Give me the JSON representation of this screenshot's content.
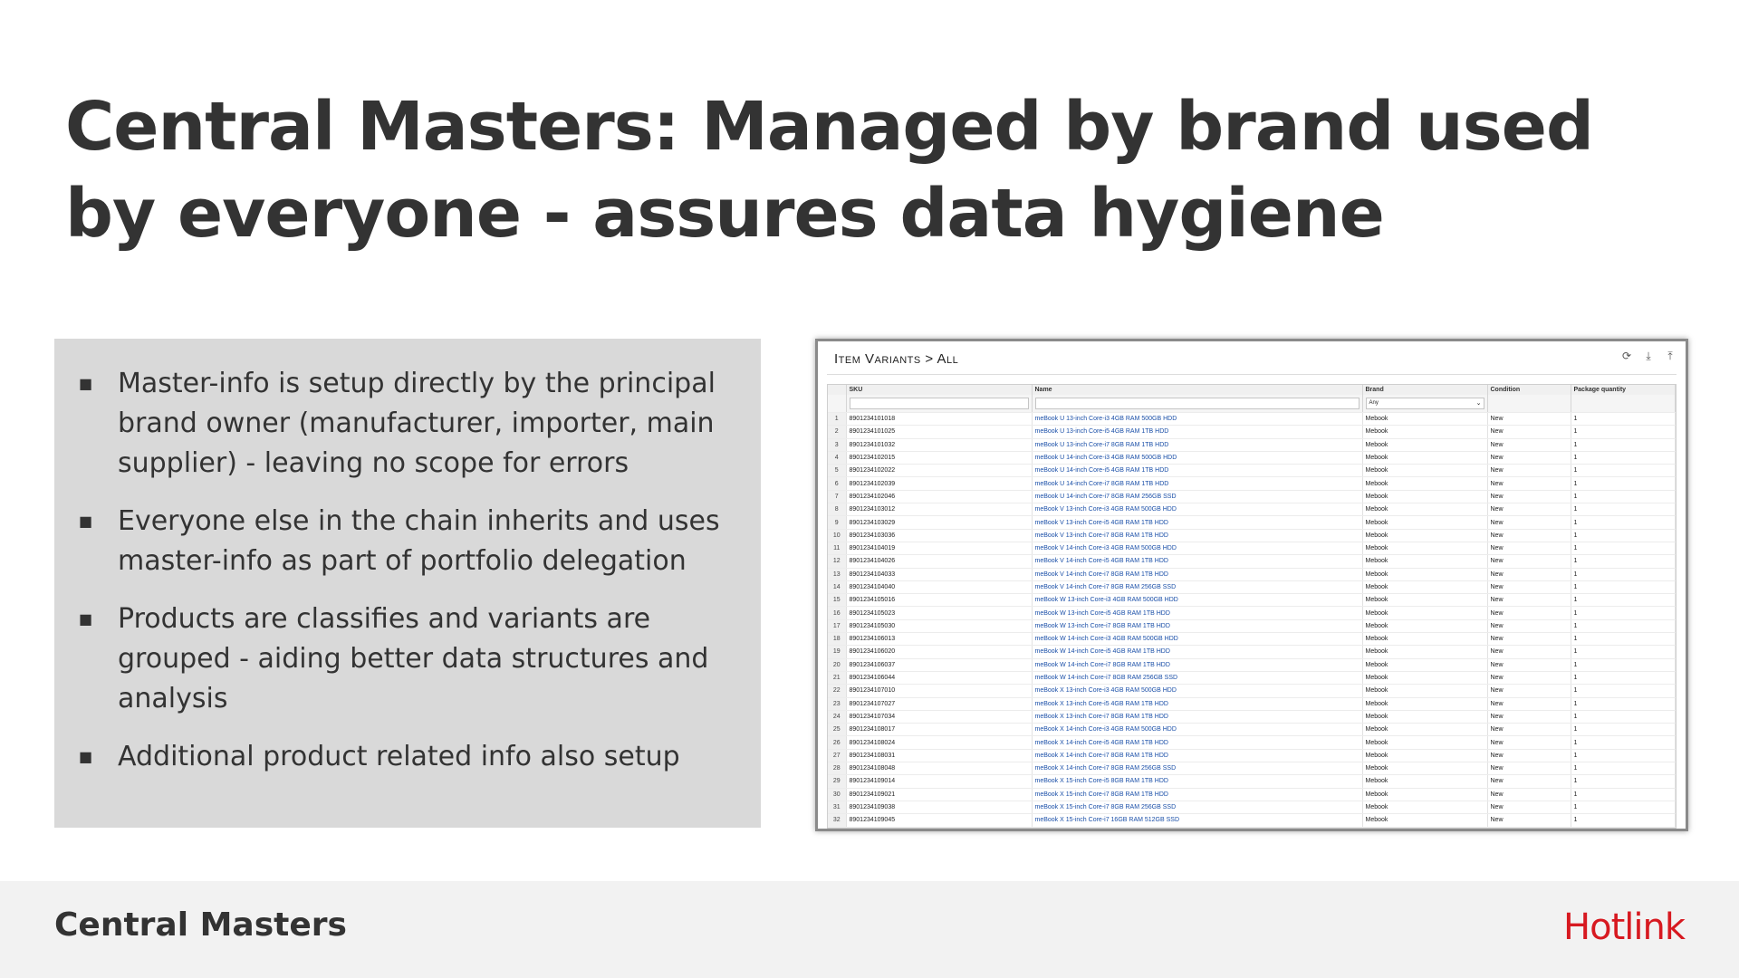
{
  "slide": {
    "title": "Central Masters: Managed by brand used by everyone - assures data hygiene",
    "bullets": [
      "Master-info is setup directly by the principal brand owner (manufacturer, importer, main supplier) - leaving no scope for errors",
      "Everyone else in the chain inherits and uses master-info as part of portfolio delegation",
      "Products are classifies and variants are grouped - aiding better data structures and analysis",
      "Additional product related info also setup"
    ],
    "bullet_marker": "■"
  },
  "screenshot": {
    "title": "Item Variants > All",
    "icons": [
      "refresh-icon",
      "download-icon",
      "upload-icon"
    ],
    "columns": [
      "SKU",
      "Name",
      "Brand",
      "Condition",
      "Package quantity"
    ],
    "filters": {
      "brand_select": "Any"
    },
    "rows": [
      [
        "1",
        "8901234101018",
        "meBook U 13-inch Core-i3 4GB RAM 500GB HDD",
        "Mebook",
        "New",
        "1"
      ],
      [
        "2",
        "8901234101025",
        "meBook U 13-inch Core-i5 4GB RAM 1TB HDD",
        "Mebook",
        "New",
        "1"
      ],
      [
        "3",
        "8901234101032",
        "meBook U 13-inch Core-i7 8GB RAM 1TB HDD",
        "Mebook",
        "New",
        "1"
      ],
      [
        "4",
        "8901234102015",
        "meBook U 14-inch Core-i3 4GB RAM 500GB HDD",
        "Mebook",
        "New",
        "1"
      ],
      [
        "5",
        "8901234102022",
        "meBook U 14-inch Core-i5 4GB RAM 1TB HDD",
        "Mebook",
        "New",
        "1"
      ],
      [
        "6",
        "8901234102039",
        "meBook U 14-inch Core-i7 8GB RAM 1TB HDD",
        "Mebook",
        "New",
        "1"
      ],
      [
        "7",
        "8901234102046",
        "meBook U 14-inch Core-i7 8GB RAM 256GB SSD",
        "Mebook",
        "New",
        "1"
      ],
      [
        "8",
        "8901234103012",
        "meBook V 13-inch Core-i3 4GB RAM 500GB HDD",
        "Mebook",
        "New",
        "1"
      ],
      [
        "9",
        "8901234103029",
        "meBook V 13-inch Core-i5 4GB RAM 1TB HDD",
        "Mebook",
        "New",
        "1"
      ],
      [
        "10",
        "8901234103036",
        "meBook V 13-inch Core-i7 8GB RAM 1TB HDD",
        "Mebook",
        "New",
        "1"
      ],
      [
        "11",
        "8901234104019",
        "meBook V 14-inch Core-i3 4GB RAM 500GB HDD",
        "Mebook",
        "New",
        "1"
      ],
      [
        "12",
        "8901234104026",
        "meBook V 14-inch Core-i5 4GB RAM 1TB HDD",
        "Mebook",
        "New",
        "1"
      ],
      [
        "13",
        "8901234104033",
        "meBook V 14-inch Core-i7 8GB RAM 1TB HDD",
        "Mebook",
        "New",
        "1"
      ],
      [
        "14",
        "8901234104040",
        "meBook V 14-inch Core-i7 8GB RAM 256GB SSD",
        "Mebook",
        "New",
        "1"
      ],
      [
        "15",
        "8901234105016",
        "meBook W 13-inch Core-i3 4GB RAM 500GB HDD",
        "Mebook",
        "New",
        "1"
      ],
      [
        "16",
        "8901234105023",
        "meBook W 13-inch Core-i5 4GB RAM 1TB HDD",
        "Mebook",
        "New",
        "1"
      ],
      [
        "17",
        "8901234105030",
        "meBook W 13-inch Core-i7 8GB RAM 1TB HDD",
        "Mebook",
        "New",
        "1"
      ],
      [
        "18",
        "8901234106013",
        "meBook W 14-inch Core-i3 4GB RAM 500GB HDD",
        "Mebook",
        "New",
        "1"
      ],
      [
        "19",
        "8901234106020",
        "meBook W 14-inch Core-i5 4GB RAM 1TB HDD",
        "Mebook",
        "New",
        "1"
      ],
      [
        "20",
        "8901234106037",
        "meBook W 14-inch Core-i7 8GB RAM 1TB HDD",
        "Mebook",
        "New",
        "1"
      ],
      [
        "21",
        "8901234106044",
        "meBook W 14-inch Core-i7 8GB RAM 256GB SSD",
        "Mebook",
        "New",
        "1"
      ],
      [
        "22",
        "8901234107010",
        "meBook X 13-inch Core-i3 4GB RAM 500GB HDD",
        "Mebook",
        "New",
        "1"
      ],
      [
        "23",
        "8901234107027",
        "meBook X 13-inch Core-i5 4GB RAM 1TB HDD",
        "Mebook",
        "New",
        "1"
      ],
      [
        "24",
        "8901234107034",
        "meBook X 13-inch Core-i7 8GB RAM 1TB HDD",
        "Mebook",
        "New",
        "1"
      ],
      [
        "25",
        "8901234108017",
        "meBook X 14-inch Core-i3 4GB RAM 500GB HDD",
        "Mebook",
        "New",
        "1"
      ],
      [
        "26",
        "8901234108024",
        "meBook X 14-inch Core-i5 4GB RAM 1TB HDD",
        "Mebook",
        "New",
        "1"
      ],
      [
        "27",
        "8901234108031",
        "meBook X 14-inch Core-i7 8GB RAM 1TB HDD",
        "Mebook",
        "New",
        "1"
      ],
      [
        "28",
        "8901234108048",
        "meBook X 14-inch Core-i7 8GB RAM 256GB SSD",
        "Mebook",
        "New",
        "1"
      ],
      [
        "29",
        "8901234109014",
        "meBook X 15-inch Core-i5 8GB RAM 1TB HDD",
        "Mebook",
        "New",
        "1"
      ],
      [
        "30",
        "8901234109021",
        "meBook X 15-inch Core-i7 8GB RAM 1TB HDD",
        "Mebook",
        "New",
        "1"
      ],
      [
        "31",
        "8901234109038",
        "meBook X 15-inch Core-i7 8GB RAM 256GB SSD",
        "Mebook",
        "New",
        "1"
      ],
      [
        "32",
        "8901234109045",
        "meBook X 15-inch Core-i7 16GB RAM 512GB SSD",
        "Mebook",
        "New",
        "1"
      ]
    ]
  },
  "footer": {
    "section_title": "Central Masters",
    "brand": "Hotlink"
  },
  "colors": {
    "title_text": "#333333",
    "panel_bg": "#d9d9d9",
    "footer_bg": "#f2f2f2",
    "brand_red": "#d71920",
    "link_blue": "#1a4fa8"
  }
}
